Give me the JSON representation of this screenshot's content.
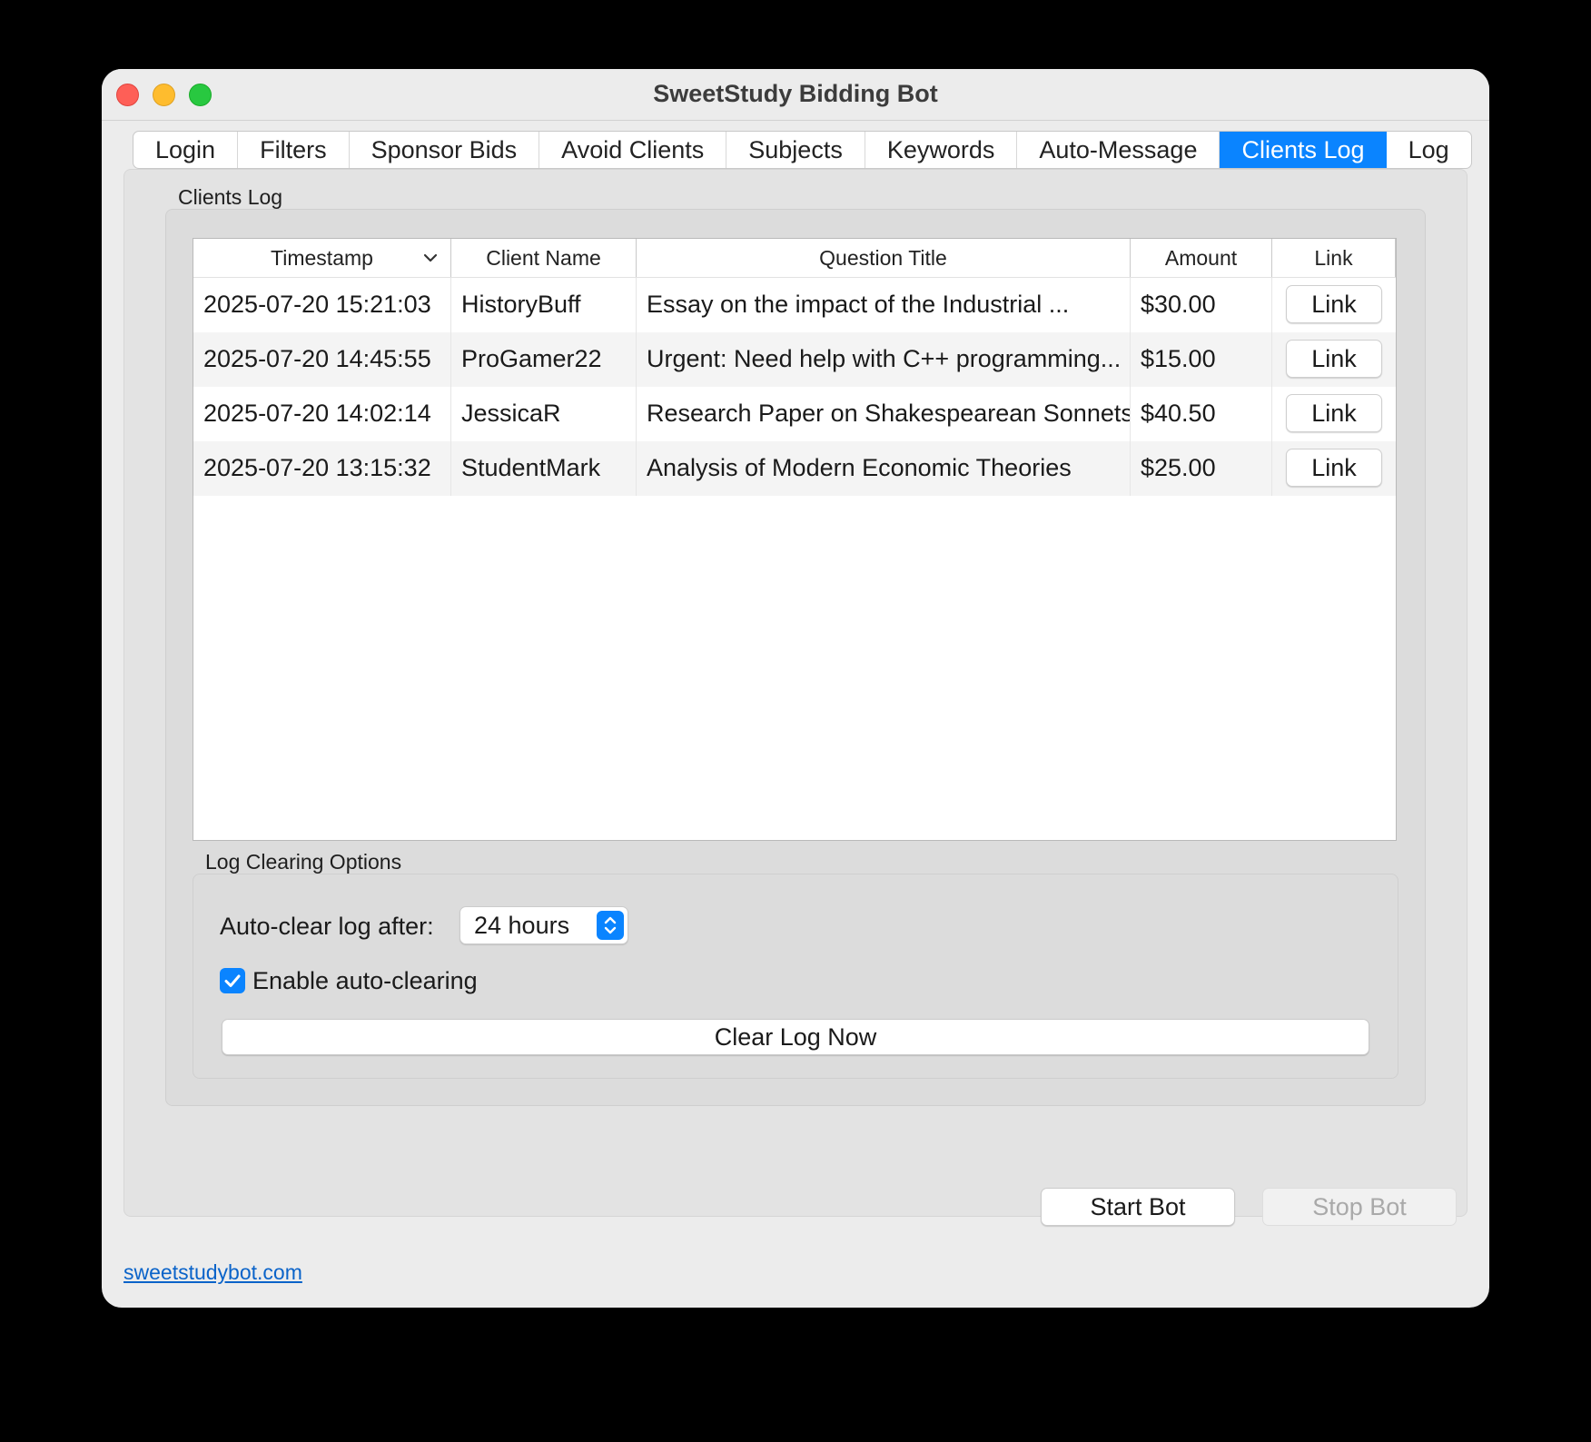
{
  "window": {
    "title": "SweetStudy Bidding Bot"
  },
  "tabs": [
    {
      "label": "Login"
    },
    {
      "label": "Filters"
    },
    {
      "label": "Sponsor Bids"
    },
    {
      "label": "Avoid Clients"
    },
    {
      "label": "Subjects"
    },
    {
      "label": "Keywords"
    },
    {
      "label": "Auto-Message"
    },
    {
      "label": "Clients Log",
      "active": true
    },
    {
      "label": "Log"
    }
  ],
  "clients_log": {
    "group_label": "Clients Log",
    "columns": [
      "Timestamp",
      "Client Name",
      "Question Title",
      "Amount",
      "Link"
    ],
    "sort_icon": "chevron-down-icon",
    "rows": [
      {
        "timestamp": "2025-07-20 15:21:03",
        "client": "HistoryBuff",
        "title": "Essay on the impact of the Industrial ...",
        "amount": "$30.00",
        "link": "Link"
      },
      {
        "timestamp": "2025-07-20 14:45:55",
        "client": "ProGamer22",
        "title": "Urgent: Need help with C++ programming...",
        "amount": "$15.00",
        "link": "Link"
      },
      {
        "timestamp": "2025-07-20 14:02:14",
        "client": "JessicaR",
        "title": "Research Paper on Shakespearean Sonnets",
        "amount": "$40.50",
        "link": "Link"
      },
      {
        "timestamp": "2025-07-20 13:15:32",
        "client": "StudentMark",
        "title": "Analysis of Modern Economic Theories",
        "amount": "$25.00",
        "link": "Link"
      }
    ]
  },
  "log_clearing": {
    "group_label": "Log Clearing Options",
    "auto_clear_label": "Auto-clear log after:",
    "auto_clear_value": "24 hours",
    "enable_label": "Enable auto-clearing",
    "enable_checked": true,
    "clear_button": "Clear Log Now"
  },
  "footer": {
    "start_button": "Start Bot",
    "stop_button": "Stop Bot",
    "stop_enabled": false,
    "site_link": "sweetstudybot.com"
  },
  "colors": {
    "accent": "#0a84ff",
    "link": "#0a63c9"
  }
}
